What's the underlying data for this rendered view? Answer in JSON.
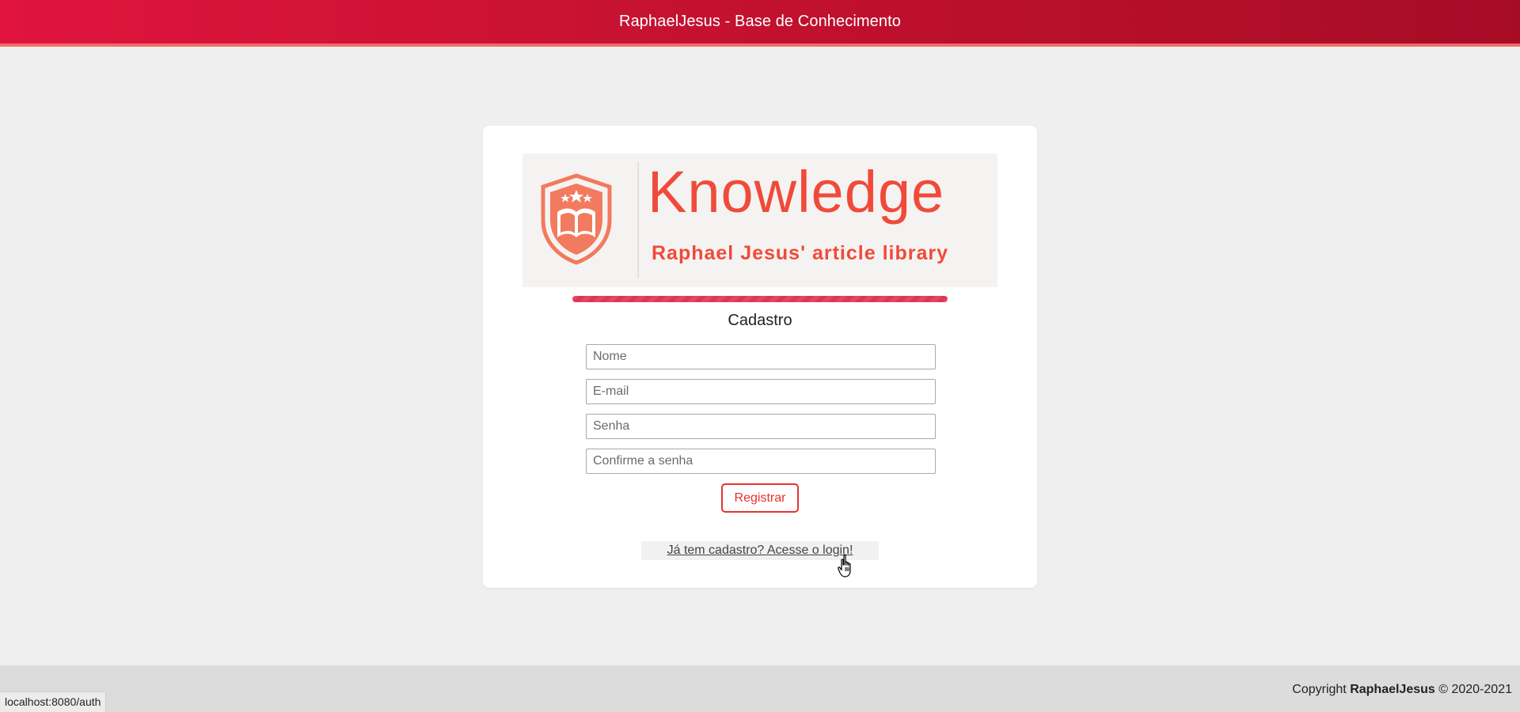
{
  "header": {
    "title": "RaphaelJesus - Base de Conhecimento"
  },
  "logo": {
    "title": "Knowledge",
    "subtitle": "Raphael Jesus' article library",
    "icon": "shield-book-icon"
  },
  "form": {
    "title": "Cadastro",
    "fields": [
      {
        "name": "name",
        "placeholder": "Nome",
        "value": ""
      },
      {
        "name": "email",
        "placeholder": "E-mail",
        "value": ""
      },
      {
        "name": "password",
        "placeholder": "Senha",
        "value": ""
      },
      {
        "name": "confirm_password",
        "placeholder": "Confirme a senha",
        "value": ""
      }
    ],
    "submit_label": "Registrar",
    "login_link": "Já tem cadastro? Acesse o login!"
  },
  "footer": {
    "copyright_prefix": "Copyright ",
    "copyright_name": "RaphaelJesus",
    "copyright_suffix": " © 2020-2021"
  },
  "status_bar": {
    "url": "localhost:8080/auth"
  },
  "colors": {
    "accent": "#e8322c",
    "header_start": "#e0143f",
    "header_end": "#a70c27",
    "logo": "#f04a3a"
  }
}
